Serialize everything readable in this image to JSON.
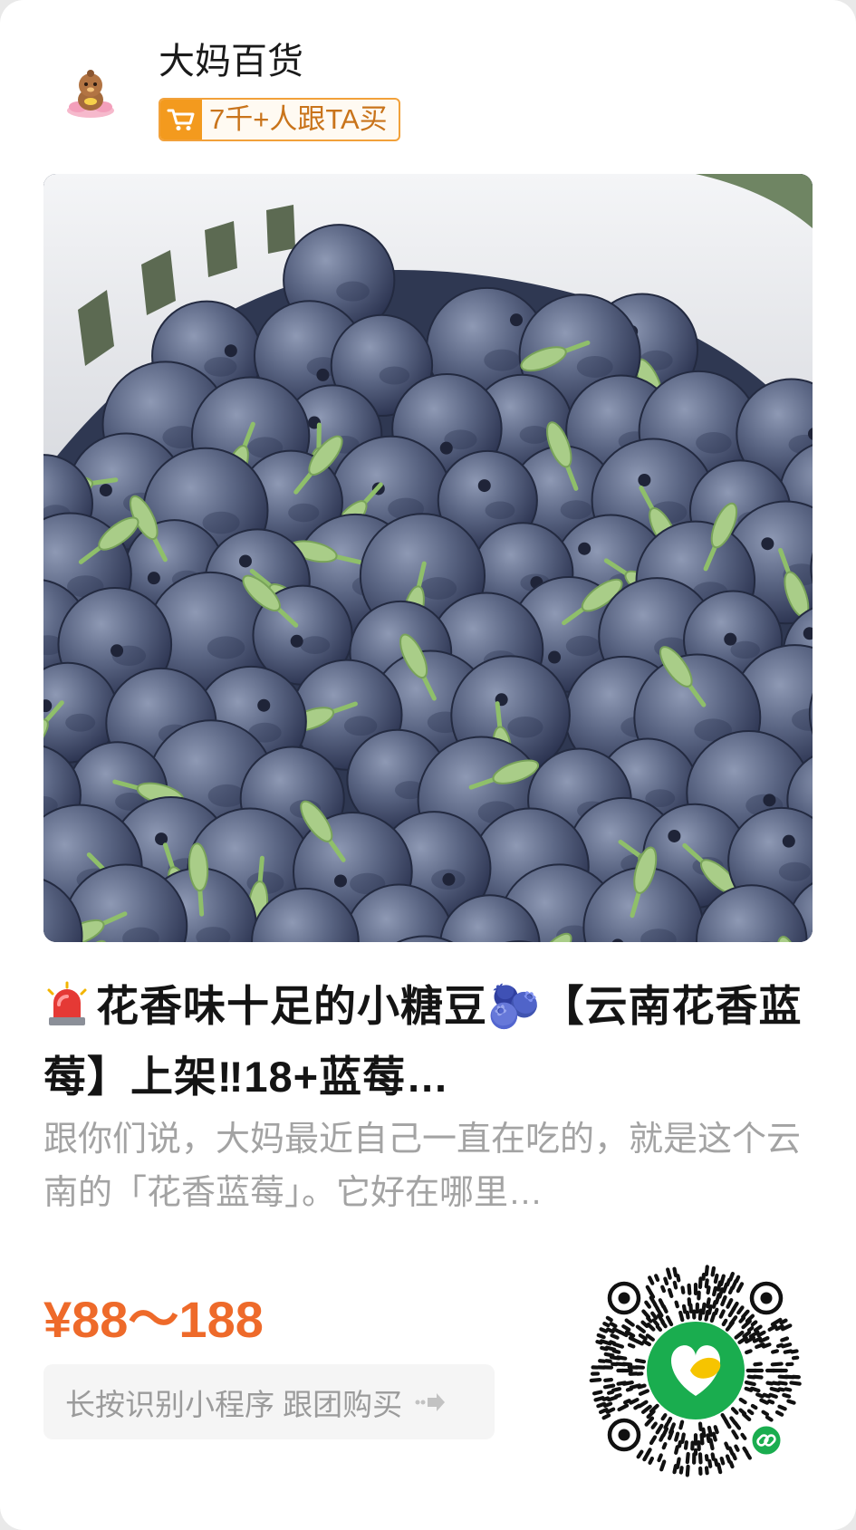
{
  "store": {
    "name": "大妈百货",
    "avatar_icon": "mascot-avatar-icon",
    "badge": {
      "icon": "cart-icon",
      "text": "7千+人跟TA买"
    }
  },
  "product": {
    "image": "blueberries-in-basket-photo",
    "title_icon": "siren-icon",
    "title": "花香味十足的小糖豆🫐【云南花香蓝莓】上架‼18+蓝莓…",
    "description": "跟你们说，大妈最近自己一直在吃的，就是这个云南的「花香蓝莓」。它好在哪里…",
    "price": "¥88～188"
  },
  "action": {
    "button_label": "长按识别小程序 跟团购买",
    "button_icon": "swipe-arrow-icon"
  },
  "mini_program_code": {
    "icon": "mini-program-code",
    "center_logo": "app-logo-icon",
    "corner_badge": "mini-program-link-icon"
  },
  "colors": {
    "accent": "#ee6a2a",
    "badge_border": "#f2a13a",
    "badge_fill": "#f39a1e",
    "code_green": "#1aad4f",
    "text_primary": "#141414",
    "text_secondary": "#a3a3a3"
  }
}
